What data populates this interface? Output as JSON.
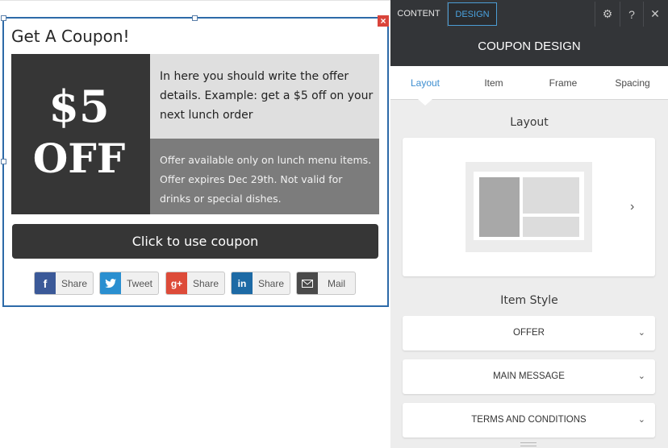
{
  "colors": {
    "selection_blue": "#2d6aa8",
    "offer_bg": "#363636",
    "details_bg": "#dfdfdf",
    "terms_bg": "#7c7c7c",
    "facebook": "#3b5998",
    "twitter": "#2a8fd0",
    "googleplus": "#dd4b39",
    "linkedin": "#1d6aa5",
    "mail": "#4a4a4a",
    "panel_dark": "#333538",
    "accent_blue": "#3d8ed0"
  },
  "coupon": {
    "title": "Get A Coupon!",
    "offer_amount": "$5",
    "offer_off": "OFF",
    "details": "In here you should write the offer details. Example: get a $5 off on your next lunch order",
    "terms": "Offer available only on lunch menu items. Offer expires Dec 29th. Not valid for drinks or special dishes.",
    "button_label": "Click to use coupon",
    "close_glyph": "×"
  },
  "share": [
    {
      "icon": "facebook-icon",
      "glyph": "f",
      "label": "Share"
    },
    {
      "icon": "twitter-icon",
      "glyph": "✉",
      "label": "Tweet"
    },
    {
      "icon": "google-plus-icon",
      "glyph": "g+",
      "label": "Share"
    },
    {
      "icon": "linkedin-icon",
      "glyph": "in",
      "label": "Share"
    },
    {
      "icon": "mail-icon",
      "glyph": "✉",
      "label": "Mail"
    }
  ],
  "panel": {
    "tabs": {
      "content": "CONTENT",
      "design": "DESIGN",
      "active": "DESIGN"
    },
    "icons": {
      "settings": "⚙",
      "help": "?",
      "close": "✕"
    },
    "title": "COUPON DESIGN",
    "subtabs": [
      "Layout",
      "Item",
      "Frame",
      "Spacing"
    ],
    "active_subtab": "Layout",
    "layout_label": "Layout",
    "layout_next": "›",
    "item_style_label": "Item Style",
    "style_rows": [
      "OFFER",
      "MAIN MESSAGE",
      "TERMS AND CONDITIONS"
    ],
    "chevron": "⌄"
  }
}
